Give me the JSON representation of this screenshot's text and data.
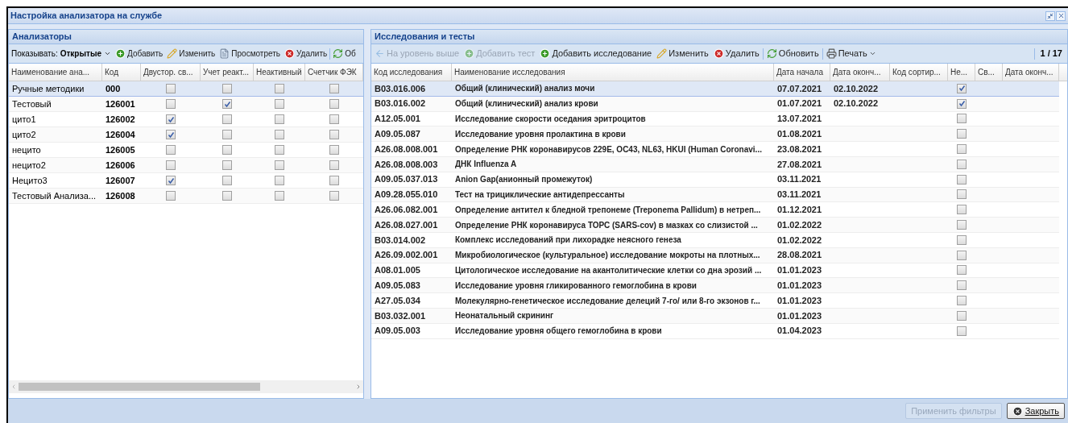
{
  "window": {
    "title": "Настройка анализатора на службе"
  },
  "analyzers": {
    "title": "Анализаторы",
    "toolbar": {
      "show_label": "Показывать:",
      "show_value": "Открытые",
      "buttons": [
        {
          "kind": "add",
          "label": "Добавить",
          "disabled": false
        },
        {
          "kind": "edit",
          "label": "Изменить",
          "disabled": false
        },
        {
          "kind": "view",
          "label": "Просмотреть",
          "disabled": false
        },
        {
          "kind": "delete",
          "label": "Удалить",
          "disabled": false
        },
        {
          "kind": "refresh",
          "label": "Об",
          "disabled": false
        }
      ]
    },
    "columns": [
      "Наименование ана...",
      "Код",
      "Двустор. св...",
      "Учет реакт...",
      "Неактивный",
      "Счетчик ФЭК"
    ],
    "rows": [
      {
        "name": "Ручные методики",
        "code": "000",
        "checks": [
          false,
          false,
          false,
          false
        ],
        "selected": true
      },
      {
        "name": "Тестовый",
        "code": "126001",
        "checks": [
          false,
          true,
          false,
          false
        ],
        "selected": false
      },
      {
        "name": "цито1",
        "code": "126002",
        "checks": [
          true,
          false,
          false,
          false
        ],
        "selected": false
      },
      {
        "name": "цито2",
        "code": "126004",
        "checks": [
          true,
          false,
          false,
          false
        ],
        "selected": false
      },
      {
        "name": "нецито",
        "code": "126005",
        "checks": [
          false,
          false,
          false,
          false
        ],
        "selected": false
      },
      {
        "name": "нецито2",
        "code": "126006",
        "checks": [
          false,
          false,
          false,
          false
        ],
        "selected": false
      },
      {
        "name": "Нецито3",
        "code": "126007",
        "checks": [
          true,
          false,
          false,
          false
        ],
        "selected": false
      },
      {
        "name": "Тестовый Анализа...",
        "code": "126008",
        "checks": [
          false,
          false,
          false,
          false
        ],
        "selected": false
      }
    ]
  },
  "tests": {
    "title": "Исследования и тесты",
    "toolbar": {
      "buttons": [
        {
          "kind": "up",
          "label": "На уровень выше",
          "disabled": true
        },
        {
          "kind": "add",
          "label": "Добавить тест",
          "disabled": true
        },
        {
          "kind": "add",
          "label": "Добавить исследование",
          "disabled": false
        },
        {
          "kind": "edit",
          "label": "Изменить",
          "disabled": false
        },
        {
          "kind": "delete",
          "label": "Удалить",
          "disabled": false
        },
        {
          "kind": "refresh",
          "label": "Обновить",
          "disabled": false
        },
        {
          "kind": "print",
          "label": "Печать",
          "disabled": false
        }
      ],
      "page": "1 / 17"
    },
    "columns": [
      "Код исследования",
      "Наименование исследования",
      "Дата начала",
      "Дата оконч...",
      "Код сортир...",
      "Не...",
      "Св...",
      "Дата оконч..."
    ],
    "rows": [
      {
        "code": "B03.016.006",
        "name": "Общий (клинический) анализ мочи",
        "start": "07.07.2021",
        "end": "02.10.2022",
        "inactive": true,
        "selected": true
      },
      {
        "code": "B03.016.002",
        "name": "Общий (клинический) анализ крови",
        "start": "01.07.2021",
        "end": "02.10.2022",
        "inactive": true,
        "selected": false
      },
      {
        "code": "A12.05.001",
        "name": "Исследование скорости оседания эритроцитов",
        "start": "13.07.2021",
        "inactive": false,
        "selected": false
      },
      {
        "code": "A09.05.087",
        "name": "Исследование уровня пролактина в крови",
        "start": "01.08.2021",
        "inactive": false,
        "selected": false
      },
      {
        "code": "A26.08.008.001",
        "name": "Определение РНК коронавирусов 229E, OC43, NL63, HKUI (Human Coronavi...",
        "start": "23.08.2021",
        "inactive": false,
        "selected": false
      },
      {
        "code": "A26.08.008.003",
        "name": "ДНК Influenza A",
        "start": "27.08.2021",
        "inactive": false,
        "selected": false
      },
      {
        "code": "A09.05.037.013",
        "name": "Anion Gap(анионный промежуток)",
        "start": "03.11.2021",
        "inactive": false,
        "selected": false
      },
      {
        "code": "A09.28.055.010",
        "name": "Тест на трициклические антидепрессанты",
        "start": "03.11.2021",
        "inactive": false,
        "selected": false
      },
      {
        "code": "A26.06.082.001",
        "name": "Определение антител к бледной трепонеме (Treponema Pallidum) в нетреп...",
        "start": "01.12.2021",
        "inactive": false,
        "selected": false
      },
      {
        "code": "A26.08.027.001",
        "name": "Определение РНК коронавируса ТОРС (SARS-cov) в мазках со слизистой ...",
        "start": "01.02.2022",
        "inactive": false,
        "selected": false
      },
      {
        "code": "B03.014.002",
        "name": "Комплекс исследований при лихорадке неясного генеза",
        "start": "01.02.2022",
        "inactive": false,
        "selected": false
      },
      {
        "code": "A26.09.002.001",
        "name": "Микробиологическое (культуральное) исследование мокроты на плотных...",
        "start": "28.08.2021",
        "inactive": false,
        "selected": false
      },
      {
        "code": "A08.01.005",
        "name": "Цитологическое исследование на акантолитические клетки со дна эрозий ...",
        "start": "01.01.2023",
        "inactive": false,
        "selected": false
      },
      {
        "code": "A09.05.083",
        "name": "Исследование уровня гликированного гемоглобина в крови",
        "start": "01.01.2023",
        "inactive": false,
        "selected": false
      },
      {
        "code": "A27.05.034",
        "name": "Молекулярно-генетическое исследование делеций 7-го/ или 8-го экзонов г...",
        "start": "01.01.2023",
        "inactive": false,
        "selected": false
      },
      {
        "code": "B03.032.001",
        "name": "Неонатальный скрининг",
        "start": "01.01.2023",
        "inactive": false,
        "selected": false
      },
      {
        "code": "A09.05.003",
        "name": "Исследование уровня общего гемоглобина в крови",
        "start": "01.04.2023",
        "inactive": false,
        "selected": false
      }
    ]
  },
  "footer": {
    "buttons": [
      {
        "kind": "apply",
        "label": "Применить фильтры",
        "disabled": true
      },
      {
        "kind": "close",
        "label": "Закрыть",
        "disabled": false
      }
    ]
  }
}
